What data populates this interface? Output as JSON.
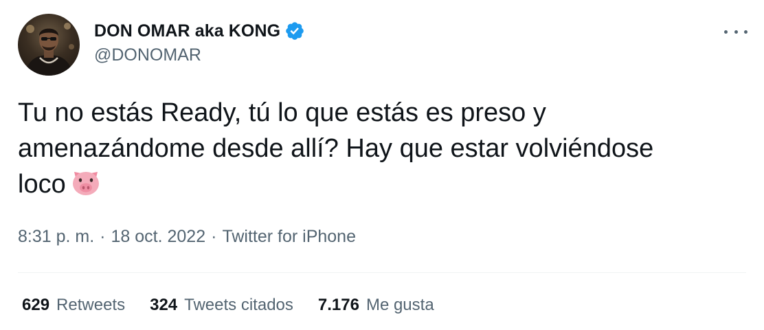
{
  "author": {
    "display_name": "DON OMAR aka KONG",
    "handle": "@DONOMAR",
    "verified": true,
    "verified_color": "#1d9bf0"
  },
  "tweet": {
    "text_line1": "Tu no estás Ready, tú lo que estás es preso y",
    "text_line2": "amenazándome desde allí? Hay que estar volviéndose",
    "text_line3": "loco",
    "emoji": "pig-face-icon"
  },
  "meta": {
    "time": "8:31 p. m.",
    "separator": "·",
    "date": "18 oct. 2022",
    "source": "Twitter for iPhone"
  },
  "stats": [
    {
      "count": "629",
      "label": "Retweets"
    },
    {
      "count": "324",
      "label": "Tweets citados"
    },
    {
      "count": "7.176",
      "label": "Me gusta"
    }
  ],
  "colors": {
    "text_primary": "#0f1419",
    "text_secondary": "#536471",
    "divider": "#eff3f4",
    "pig_pink": "#f4abba"
  }
}
